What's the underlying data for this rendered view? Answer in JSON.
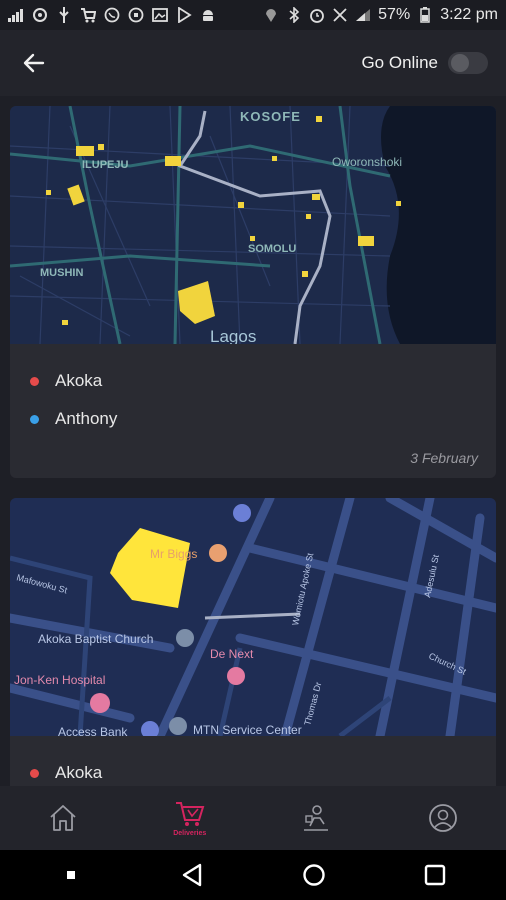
{
  "status_bar": {
    "battery": "57%",
    "time": "3:22 pm"
  },
  "header": {
    "go_online_label": "Go Online",
    "go_online_enabled": false
  },
  "trips": [
    {
      "map": {
        "labels": [
          "KOSOFE",
          "ILUPEJU",
          "Oworonshoki",
          "SOMOLU",
          "MUSHIN",
          "Lagos"
        ]
      },
      "stops": [
        {
          "label": "Akoka",
          "color": "#e54b4b"
        },
        {
          "label": "Anthony",
          "color": "#3aa0e8"
        }
      ],
      "date": "3 February"
    },
    {
      "map": {
        "labels": [
          "Mr Biggs",
          "Mafowoku St",
          "Akoka Baptist Church",
          "De Next",
          "Jon-Ken Hospital",
          "Access Bank",
          "MTN Service Center",
          "Thomas Dr",
          "Adesulu St",
          "Church St",
          "Womiotu Apoke St"
        ]
      },
      "stops": [
        {
          "label": "Akoka",
          "color": "#e54b4b"
        }
      ]
    }
  ],
  "bottom_nav": {
    "items": [
      {
        "icon": "home-icon"
      },
      {
        "icon": "deliveries-icon",
        "label": "Deliveries",
        "active": true
      },
      {
        "icon": "delivery-person-icon"
      },
      {
        "icon": "profile-icon"
      }
    ],
    "active_color": "#d4245f"
  }
}
